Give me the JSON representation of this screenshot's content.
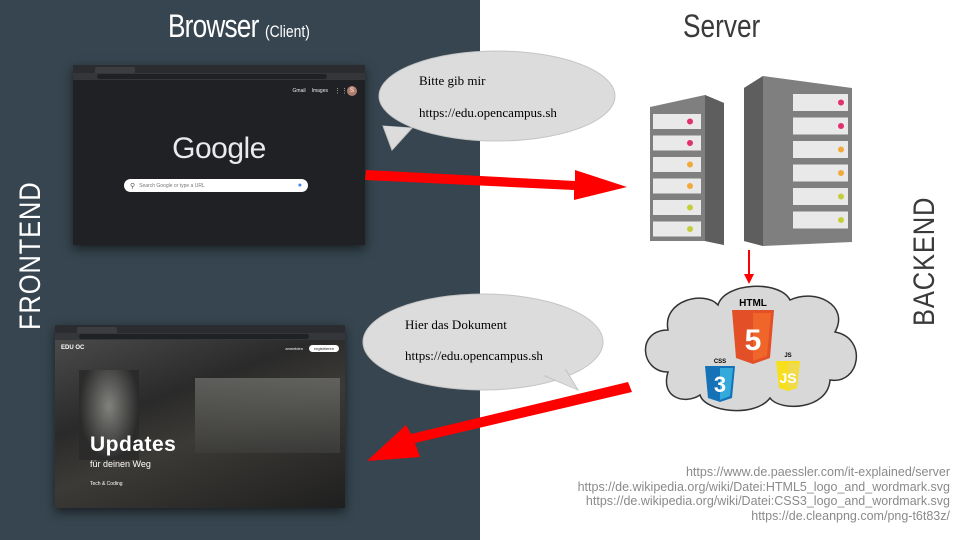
{
  "titles": {
    "browser": "Browser",
    "browser_sub": "(Client)",
    "server": "Server",
    "frontend": "FRONTEND",
    "backend": "BACKEND"
  },
  "bubbles": {
    "request": {
      "line1": "Bitte gib mir",
      "line2": "https://edu.opencampus.sh"
    },
    "response": {
      "line1": "Hier das Dokument",
      "line2": "https://edu.opencampus.sh"
    }
  },
  "google_window": {
    "links": [
      "Gmail",
      "Images"
    ],
    "account_initial": "S",
    "logo": "Google",
    "search_placeholder": "Search Google or type a URL"
  },
  "updates_window": {
    "logo": "EDU OC",
    "nav_buttons": [
      "anmelden",
      "registrieren"
    ],
    "headline": "Updates",
    "subline": "für deinen Weg",
    "tag": "Tech & Coding"
  },
  "cloud": {
    "html_label": "HTML",
    "html_number": "5",
    "css_label": "CSS",
    "css_number": "3",
    "js_label": "JS"
  },
  "sources": [
    "https://www.de.paessler.com/it-explained/server",
    "https://de.wikipedia.org/wiki/Datei:HTML5_logo_and_wordmark.svg",
    "https://de.wikipedia.org/wiki/Datei:CSS3_logo_and_wordmark.svg",
    "https://de.cleanpng.com/png-t6t83z/"
  ],
  "colors": {
    "left_panel": "#36454f",
    "arrow": "#ff0000",
    "server": "#7f7f7f",
    "bubble": "#dcdcdc",
    "html5": "#e34f26",
    "css3": "#1572b6",
    "js": "#f7df1e"
  },
  "icons": [
    "server-icon",
    "cloud-icon",
    "html5-icon",
    "css3-icon",
    "js-icon",
    "arrow-icon"
  ]
}
